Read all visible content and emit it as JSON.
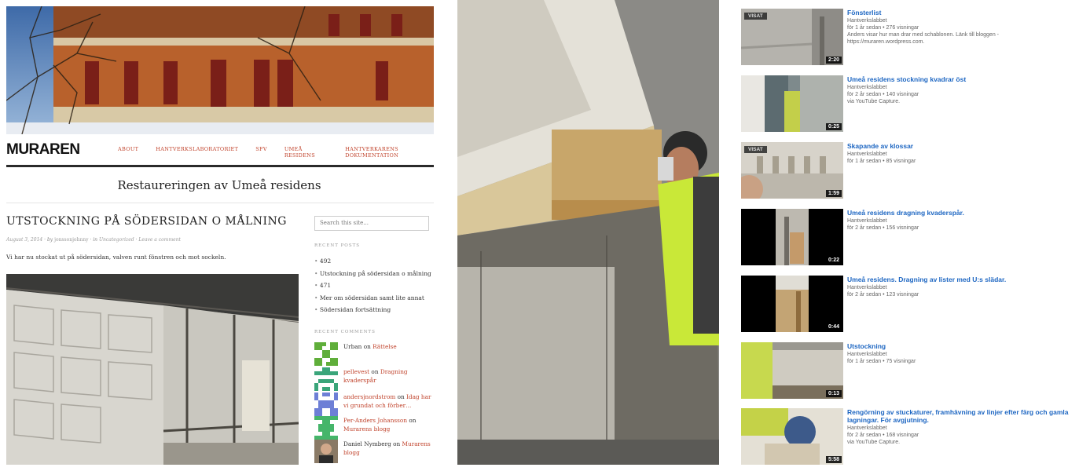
{
  "blog": {
    "site_title": "MURAREN",
    "nav": [
      "ABOUT",
      "HANTVERKSLABORATORIET",
      "SFV",
      "UMEÅ RESIDENS",
      "HANTVERKARENS DOKUMENTATION"
    ],
    "tagline": "Restaureringen av Umeå residens",
    "post": {
      "title": "UTSTOCKNING PÅ SÖDERSIDAN O MÅLNING",
      "meta_date": "August 3, 2014",
      "meta_by": "by",
      "meta_author": "jonssonjohnny",
      "meta_in": "in",
      "meta_category": "Uncategorized",
      "meta_comment": "Leave a comment",
      "excerpt": "Vi har nu stockat ut på södersidan, valven runt fönstren och mot sockeln."
    },
    "sidebar": {
      "search_placeholder": "Search this site...",
      "recent_posts_heading": "RECENT POSTS",
      "recent_posts": [
        "492",
        "Utstockning på södersidan o målning",
        "471",
        "Mer om södersidan samt lite annat",
        "Södersidan fortsättning"
      ],
      "recent_comments_heading": "RECENT COMMENTS",
      "recent_comments": [
        {
          "author": "Urban",
          "on": "on",
          "post": "Rättelse",
          "author_link": false
        },
        {
          "author": "pellevest",
          "on": "on",
          "post": "Dragning kvaderspår",
          "author_link": true
        },
        {
          "author": "andersjnordstrom",
          "on": "on",
          "post": "Idag har vi grundat och förber…",
          "author_link": true
        },
        {
          "author": "Per-Anders Johansson",
          "on": "on",
          "post": "Murarens blogg",
          "author_link": true
        },
        {
          "author": "Daniel Nymberg",
          "on": "on",
          "post": "Murarens blogg",
          "author_link": false
        }
      ]
    }
  },
  "videos": [
    {
      "title": "Fönsterlist",
      "channel": "Hantverkslabbet",
      "stats": "för 1 år sedan • 276 visningar",
      "desc": [
        "Anders visar hur man drar med schablonen. Länk till bloggen -",
        "https://muraren.wordpress.com."
      ],
      "duration": "2:20",
      "watched": "VISAT"
    },
    {
      "title": "Umeå residens stockning kvadrar öst",
      "channel": "Hantverkslabbet",
      "stats": "för 2 år sedan • 140 visningar",
      "desc": [
        "via YouTube Capture."
      ],
      "duration": "0:25",
      "watched": ""
    },
    {
      "title": "Skapande av klossar",
      "channel": "Hantverkslabbet",
      "stats": "för 1 år sedan • 85 visningar",
      "desc": [],
      "duration": "1:59",
      "watched": "VISAT"
    },
    {
      "title": "Umeå residens dragning kvaderspår.",
      "channel": "Hantverkslabbet",
      "stats": "för 2 år sedan • 156 visningar",
      "desc": [],
      "duration": "0:22",
      "watched": ""
    },
    {
      "title": "Umeå residens. Dragning av lister med U:s slädar.",
      "channel": "Hantverkslabbet",
      "stats": "för 2 år sedan • 123 visningar",
      "desc": [],
      "duration": "0:44",
      "watched": ""
    },
    {
      "title": "Utstockning",
      "channel": "Hantverkslabbet",
      "stats": "för 1 år sedan • 75 visningar",
      "desc": [],
      "duration": "0:13",
      "watched": ""
    },
    {
      "title": "Rengörning av stuckaturer, framhävning av linjer efter färg och gamla lagningar. För avgjutning.",
      "channel": "Hantverkslabbet",
      "stats": "för 2 år sedan • 168 visningar",
      "desc": [
        "via YouTube Capture."
      ],
      "duration": "5:58",
      "watched": ""
    }
  ],
  "colors": {
    "accent_link": "#c1442d",
    "video_title": "#1d66c2"
  }
}
